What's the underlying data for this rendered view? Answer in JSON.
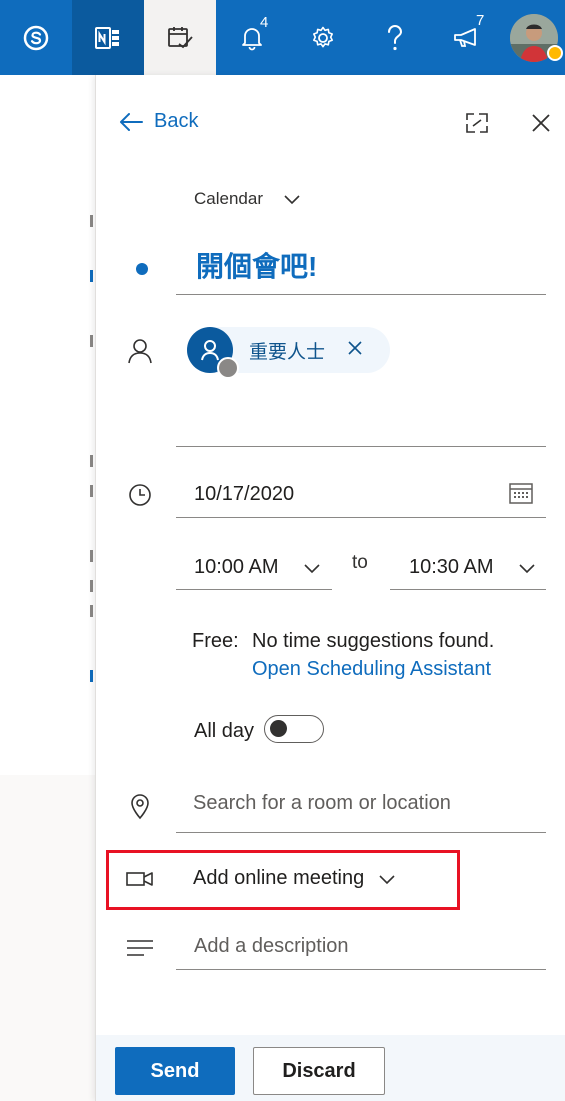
{
  "topbar": {
    "items": [
      {
        "icon": "skype-icon"
      },
      {
        "icon": "onenote-icon"
      },
      {
        "icon": "my-day-calendar-icon"
      },
      {
        "icon": "notifications-bell-icon",
        "badge": "4"
      },
      {
        "icon": "settings-gear-icon"
      },
      {
        "icon": "help-question-icon"
      },
      {
        "icon": "feedback-megaphone-icon",
        "badge": "7"
      },
      {
        "icon": "user-avatar"
      }
    ],
    "colors": {
      "bar": "#0f6cbd",
      "active": "#f3f2f1"
    }
  },
  "panel": {
    "back_label": "Back",
    "calendar_label": "Calendar",
    "title_value": "開個會吧!",
    "attendee": {
      "name": "重要人士"
    },
    "date": "10/17/2020",
    "start_time": "10:00 AM",
    "to_label": "to",
    "end_time": "10:30 AM",
    "free_label": "Free:",
    "suggestion_text": "No time suggestions found.",
    "scheduling_link": "Open Scheduling Assistant",
    "all_day_label": "All day",
    "all_day_on": false,
    "location_placeholder": "Search for a room or location",
    "online_meeting_label": "Add online meeting",
    "description_placeholder": "Add a description",
    "send_label": "Send",
    "discard_label": "Discard"
  },
  "colors": {
    "accent": "#0f6cbd",
    "highlight": "#e81123"
  }
}
